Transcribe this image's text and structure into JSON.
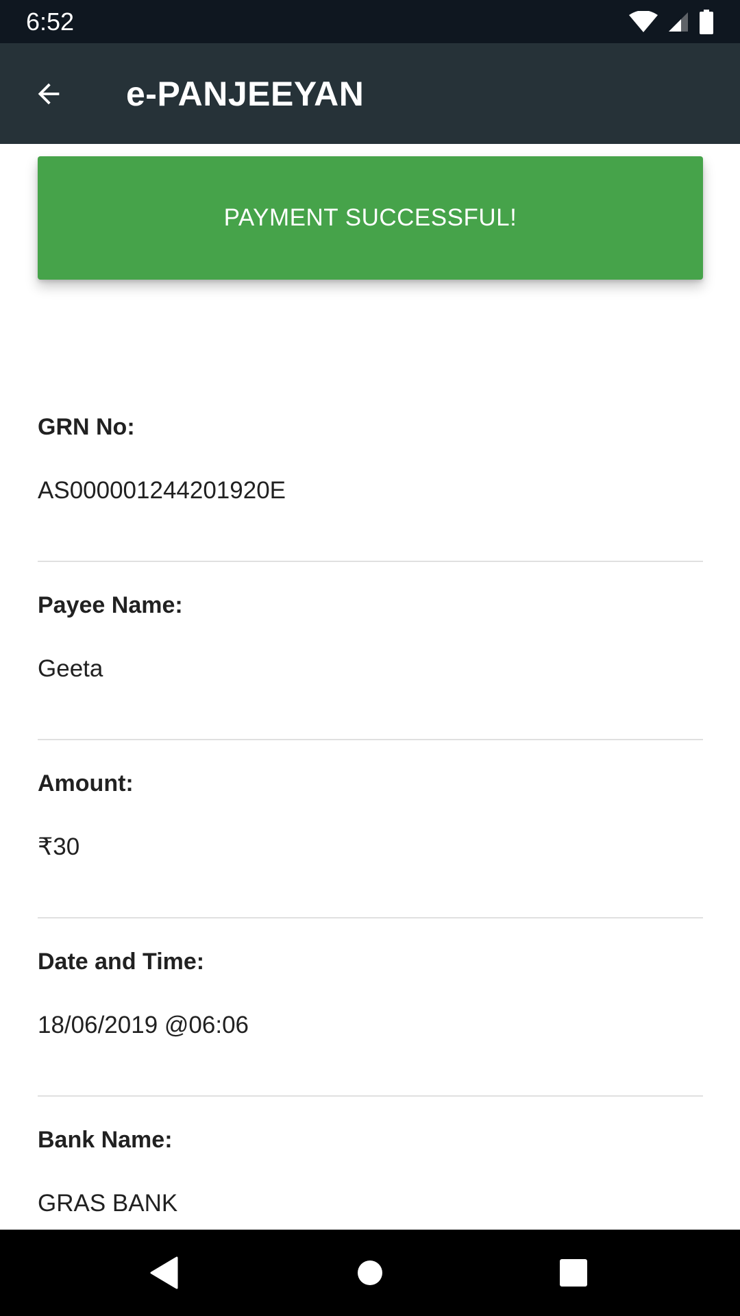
{
  "status_bar": {
    "time": "6:52",
    "icons": [
      "wifi-icon",
      "cell-signal-icon",
      "battery-icon"
    ]
  },
  "app_bar": {
    "title": "e-PANJEEYAN",
    "back_icon": "arrow-back-icon"
  },
  "banner": {
    "text": "PAYMENT SUCCESSFUL!",
    "color": "#46a34a"
  },
  "details": [
    {
      "label": "GRN No:",
      "value": "AS000001244201920E"
    },
    {
      "label": "Payee Name:",
      "value": "Geeta"
    },
    {
      "label": "Amount:",
      "value": "₹30"
    },
    {
      "label": "Date and Time:",
      "value": "18/06/2019 @06:06"
    },
    {
      "label": "Bank Name:",
      "value": "GRAS BANK"
    }
  ],
  "nav_bar": {
    "icons": [
      "nav-back-icon",
      "nav-home-icon",
      "nav-recents-icon"
    ]
  }
}
